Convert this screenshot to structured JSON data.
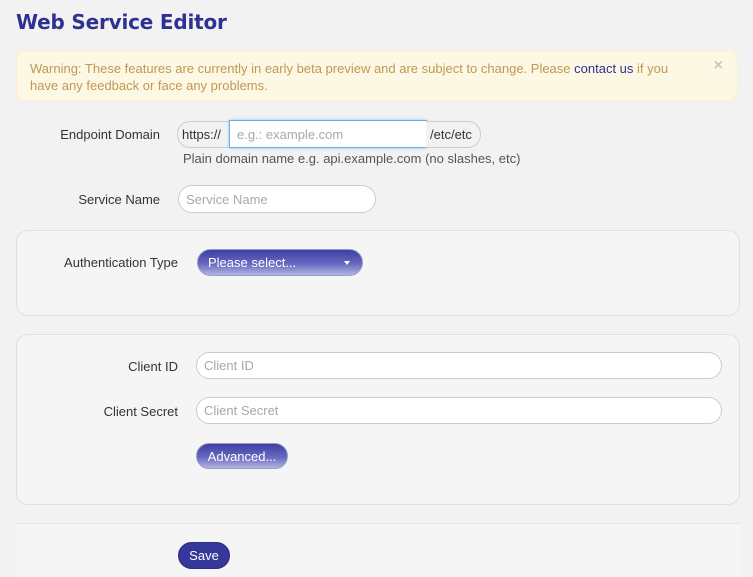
{
  "page": {
    "title": "Web Service Editor"
  },
  "alert": {
    "text_before": "Warning: These features are currently in early beta preview and are subject to change. Please ",
    "link_text": "contact us",
    "text_after": " if you have any feedback or face any problems.",
    "close_symbol": "×"
  },
  "endpoint": {
    "label": "Endpoint Domain",
    "prefix": "https://",
    "placeholder": "e.g.: example.com",
    "suffix": "/etc/etc",
    "help": "Plain domain name e.g. api.example.com (no slashes, etc)"
  },
  "service": {
    "label": "Service Name",
    "placeholder": "Service Name"
  },
  "auth": {
    "label": "Authentication Type",
    "select_label": "Please select..."
  },
  "client": {
    "id_label": "Client ID",
    "id_placeholder": "Client ID",
    "secret_label": "Client Secret",
    "secret_placeholder": "Client Secret",
    "advanced_label": "Advanced..."
  },
  "footer": {
    "save_label": "Save"
  },
  "colors": {
    "title": "#2e3192",
    "alert_bg": "#fcf8e3",
    "alert_text": "#c09853",
    "link": "#2e3192",
    "button_primary": "#35379a"
  }
}
